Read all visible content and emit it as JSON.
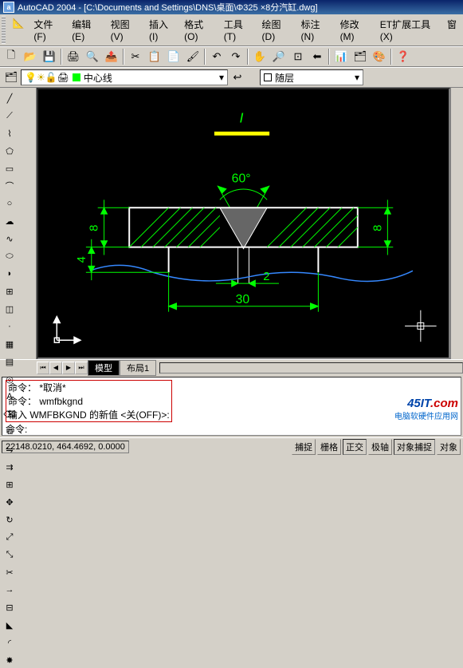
{
  "title": "AutoCAD 2004 - [C:\\Documents and Settings\\DNS\\桌面\\Φ325 ×8分汽缸.dwg]",
  "menus": {
    "file": "文件(F)",
    "edit": "编辑(E)",
    "view": "视图(V)",
    "insert": "插入(I)",
    "format": "格式(O)",
    "tools": "工具(T)",
    "draw": "绘图(D)",
    "dim": "标注(N)",
    "modify": "修改(M)",
    "ettools": "ET扩展工具(X)",
    "win": "窗"
  },
  "layer": {
    "current": "中心线",
    "layer_combo": "随层"
  },
  "tabs": {
    "model": "模型",
    "layout1": "布局1"
  },
  "cmd": {
    "l1": "命令： *取消*",
    "l2": "命令： wmfbkgnd",
    "l3": "输入 WMFBKGND 的新值 <关(OFF)>:",
    "l4": "命令:"
  },
  "status": {
    "coords": "22148.0210, 464.4692, 0.0000",
    "btns": {
      "snap": "捕捉",
      "grid": "栅格",
      "ortho": "正交",
      "polar": "极轴",
      "osnap": "对象捕捉",
      "otrack": "对象"
    }
  },
  "chart_data": {
    "type": "diagram",
    "description": "Mechanical cross-section drawing with hatched section",
    "top_label": "I",
    "dimensions": {
      "angle": "60°",
      "left_top": "8",
      "left_bottom": "4",
      "right": "8",
      "gap": "2",
      "base": "30"
    },
    "layer_color": "中心线"
  },
  "watermark": {
    "site1": "45IT",
    "site2": ".com",
    "tagline": "电脑软硬件应用网"
  }
}
